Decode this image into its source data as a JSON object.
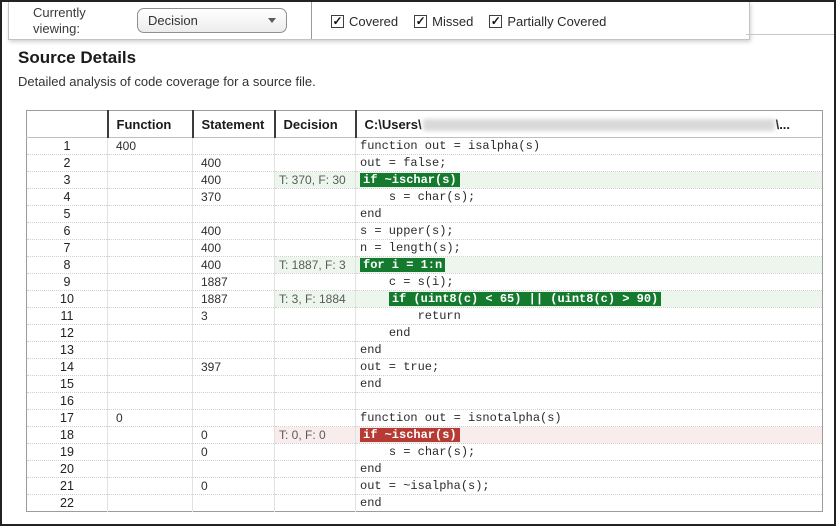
{
  "toolbar": {
    "label_line1": "Currently",
    "label_line2": "viewing:",
    "dropdown_value": "Decision",
    "checkboxes": [
      {
        "label": "Covered",
        "checked": true
      },
      {
        "label": "Missed",
        "checked": true
      },
      {
        "label": "Partially Covered",
        "checked": true
      }
    ]
  },
  "page": {
    "title": "Source Details",
    "subtitle": "Detailed analysis of code coverage for a source file."
  },
  "colors": {
    "covered_highlight": "#147a2e",
    "missed_highlight": "#b73b35",
    "covered_row_tint": "#ecf6ec",
    "missed_row_tint": "#f9ecec"
  },
  "table": {
    "headers": {
      "line": "",
      "function": "Function",
      "statement": "Statement",
      "decision": "Decision"
    },
    "path_header": {
      "prefix": "C:\\Users\\",
      "suffix": "\\...",
      "redacted": true
    },
    "rows": [
      {
        "line": "1",
        "function": "400",
        "statement": "",
        "decision": "",
        "indent": "",
        "code": "function out = isalpha(s)",
        "mark": ""
      },
      {
        "line": "2",
        "function": "",
        "statement": "400",
        "decision": "",
        "indent": "",
        "code": "out = false;",
        "mark": ""
      },
      {
        "line": "3",
        "function": "",
        "statement": "400",
        "decision": "T: 370, F: 30",
        "indent": "",
        "code": "if ~ischar(s)",
        "mark": "covered"
      },
      {
        "line": "4",
        "function": "",
        "statement": "370",
        "decision": "",
        "indent": "    ",
        "code": "s = char(s);",
        "mark": ""
      },
      {
        "line": "5",
        "function": "",
        "statement": "",
        "decision": "",
        "indent": "",
        "code": "end",
        "mark": ""
      },
      {
        "line": "6",
        "function": "",
        "statement": "400",
        "decision": "",
        "indent": "",
        "code": "s = upper(s);",
        "mark": ""
      },
      {
        "line": "7",
        "function": "",
        "statement": "400",
        "decision": "",
        "indent": "",
        "code": "n = length(s);",
        "mark": ""
      },
      {
        "line": "8",
        "function": "",
        "statement": "400",
        "decision": "T: 1887, F: 3",
        "indent": "",
        "code": "for i = 1:n",
        "mark": "covered"
      },
      {
        "line": "9",
        "function": "",
        "statement": "1887",
        "decision": "",
        "indent": "    ",
        "code": "c = s(i);",
        "mark": ""
      },
      {
        "line": "10",
        "function": "",
        "statement": "1887",
        "decision": "T: 3, F: 1884",
        "indent": "    ",
        "code": "if (uint8(c) < 65) || (uint8(c) > 90)",
        "mark": "covered"
      },
      {
        "line": "11",
        "function": "",
        "statement": "3",
        "decision": "",
        "indent": "        ",
        "code": "return",
        "mark": ""
      },
      {
        "line": "12",
        "function": "",
        "statement": "",
        "decision": "",
        "indent": "    ",
        "code": "end",
        "mark": ""
      },
      {
        "line": "13",
        "function": "",
        "statement": "",
        "decision": "",
        "indent": "",
        "code": "end",
        "mark": ""
      },
      {
        "line": "14",
        "function": "",
        "statement": "397",
        "decision": "",
        "indent": "",
        "code": "out = true;",
        "mark": ""
      },
      {
        "line": "15",
        "function": "",
        "statement": "",
        "decision": "",
        "indent": "",
        "code": "end",
        "mark": ""
      },
      {
        "line": "16",
        "function": "",
        "statement": "",
        "decision": "",
        "indent": "",
        "code": "",
        "mark": ""
      },
      {
        "line": "17",
        "function": "0",
        "statement": "",
        "decision": "",
        "indent": "",
        "code": "function out = isnotalpha(s)",
        "mark": ""
      },
      {
        "line": "18",
        "function": "",
        "statement": "0",
        "decision": "T: 0, F: 0",
        "indent": "",
        "code": "if ~ischar(s)",
        "mark": "missed"
      },
      {
        "line": "19",
        "function": "",
        "statement": "0",
        "decision": "",
        "indent": "    ",
        "code": "s = char(s);",
        "mark": ""
      },
      {
        "line": "20",
        "function": "",
        "statement": "",
        "decision": "",
        "indent": "",
        "code": "end",
        "mark": ""
      },
      {
        "line": "21",
        "function": "",
        "statement": "0",
        "decision": "",
        "indent": "",
        "code": "out = ~isalpha(s);",
        "mark": ""
      },
      {
        "line": "22",
        "function": "",
        "statement": "",
        "decision": "",
        "indent": "",
        "code": "end",
        "mark": ""
      }
    ]
  }
}
